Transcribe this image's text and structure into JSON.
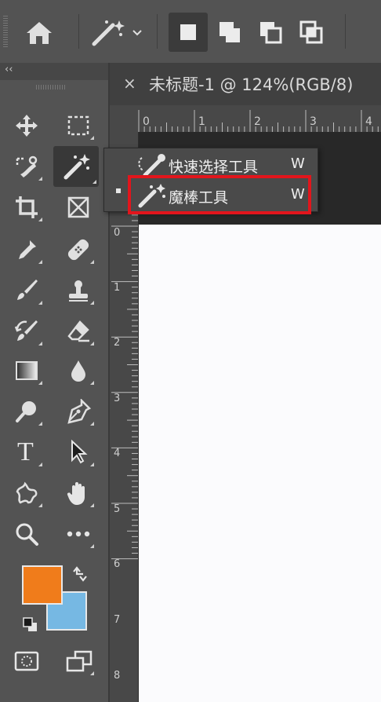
{
  "options_bar": {
    "home_icon": "home-icon",
    "tool_preset_icon": "magic-wand-icon",
    "selection_modes": [
      "new-selection-icon",
      "add-to-selection-icon",
      "subtract-from-selection-icon",
      "intersect-selection-icon"
    ]
  },
  "toolbar": {
    "collapse_label": "‹‹",
    "tools": [
      "move-tool",
      "rectangular-marquee-tool",
      "object-selection-tool",
      "magic-wand-tool",
      "crop-tool",
      "frame-tool",
      "eyedropper-tool",
      "healing-brush-tool",
      "brush-tool",
      "clone-stamp-tool",
      "history-brush-tool",
      "eraser-tool",
      "gradient-tool",
      "blur-tool",
      "dodge-tool",
      "pen-tool",
      "type-tool",
      "path-selection-tool",
      "custom-shape-tool",
      "hand-tool",
      "zoom-tool",
      "edit-toolbar-tool"
    ],
    "type_tool_glyph": "T",
    "foreground_color": "#f07c1b",
    "background_color": "#76b8e3"
  },
  "document": {
    "close_glyph": "×",
    "title": "未标题-1 @ 124%(RGB/8)"
  },
  "rulers": {
    "top_labels": [
      "0",
      "1",
      "2",
      "3",
      "4"
    ],
    "left_labels": [
      "0",
      "1",
      "2",
      "3",
      "4",
      "5",
      "6",
      "7",
      "8"
    ]
  },
  "flyout": {
    "items": [
      {
        "label": "快速选择工具",
        "shortcut": "W",
        "icon": "quick-selection-icon"
      },
      {
        "label": "魔棒工具",
        "shortcut": "W",
        "icon": "magic-wand-icon",
        "selected": true
      }
    ]
  }
}
